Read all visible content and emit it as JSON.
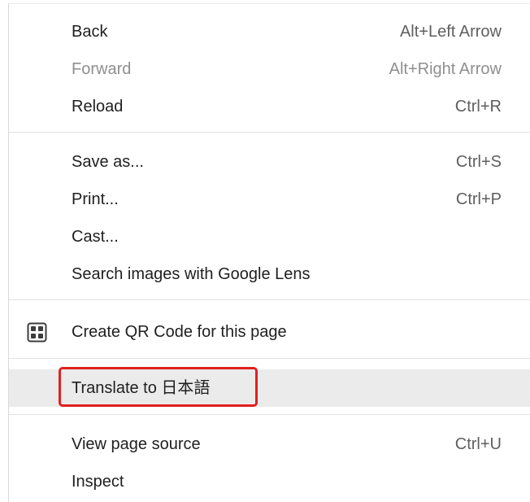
{
  "colors": {
    "highlight_row": "#ebebeb",
    "annotation_box": "#e0201f",
    "disabled_text": "#8f8f8f"
  },
  "menu": {
    "items": [
      {
        "label": "Back",
        "shortcut": "Alt+Left Arrow",
        "enabled": true
      },
      {
        "label": "Forward",
        "shortcut": "Alt+Right Arrow",
        "enabled": false
      },
      {
        "label": "Reload",
        "shortcut": "Ctrl+R",
        "enabled": true
      },
      {
        "label": "Save as...",
        "shortcut": "Ctrl+S",
        "enabled": true
      },
      {
        "label": "Print...",
        "shortcut": "Ctrl+P",
        "enabled": true
      },
      {
        "label": "Cast...",
        "shortcut": "",
        "enabled": true
      },
      {
        "label": "Search images with Google Lens",
        "shortcut": "",
        "enabled": true
      },
      {
        "label": "Create QR Code for this page",
        "shortcut": "",
        "icon": "qr-code-icon",
        "enabled": true
      },
      {
        "label": "Translate to 日本語",
        "shortcut": "",
        "enabled": true,
        "highlighted": true
      },
      {
        "label": "View page source",
        "shortcut": "Ctrl+U",
        "enabled": true
      },
      {
        "label": "Inspect",
        "shortcut": "",
        "enabled": true
      }
    ]
  }
}
